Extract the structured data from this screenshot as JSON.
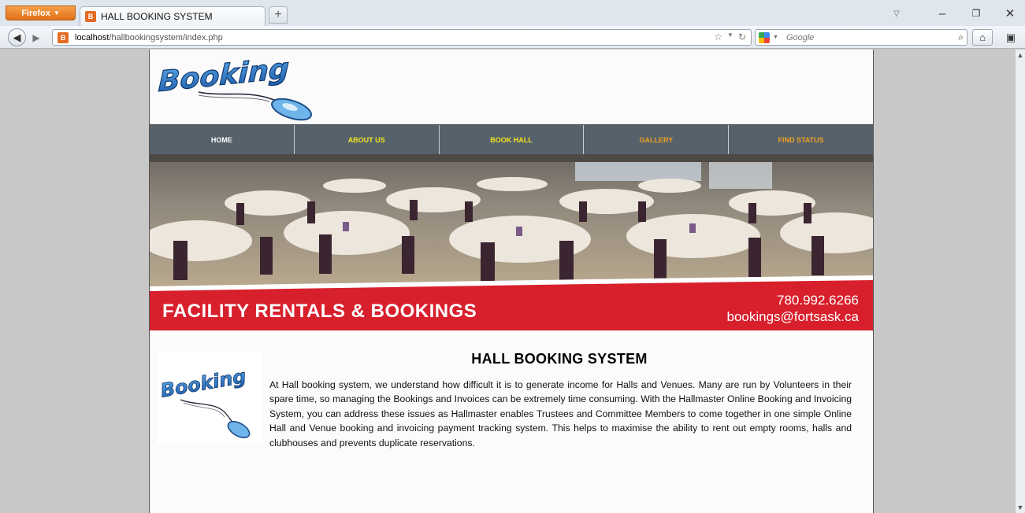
{
  "browser": {
    "menu_label": "Firefox",
    "tab_title": "HALL BOOKING SYSTEM",
    "new_tab": "+",
    "url_host": "localhost",
    "url_path": "/hallbookingsystem/index.php",
    "search_placeholder": "Google"
  },
  "logo": {
    "text": "Booking"
  },
  "menu": {
    "items": [
      {
        "label": "HOME",
        "color": "#ffffff"
      },
      {
        "label": "ABOUT US",
        "color": "#f5e51f"
      },
      {
        "label": "BOOK HALL",
        "color": "#f5e51f"
      },
      {
        "label": "GALLERY",
        "color": "#f0a020"
      },
      {
        "label": "FIND STATUS",
        "color": "#f0a020"
      }
    ]
  },
  "banner": {
    "title": "FACILITY RENTALS & BOOKINGS",
    "phone": "780.992.6266",
    "email": "bookings@fortsask.ca",
    "accent_color": "#d8202c"
  },
  "content": {
    "title": "HALL BOOKING SYSTEM",
    "paragraph": "At Hall booking system, we understand how difficult it is to generate income for Halls and Venues. Many are run by Volunteers in their spare time, so managing the Bookings and Invoices can be extremely time consuming. With the Hallmaster Online Booking and Invoicing System, you can address these issues as Hallmaster enables Trustees and Committee Members to come together in one simple Online Hall and Venue booking and invoicing payment tracking system. This helps to maximise the ability to rent out empty rooms, halls and clubhouses and prevents duplicate reservations."
  }
}
